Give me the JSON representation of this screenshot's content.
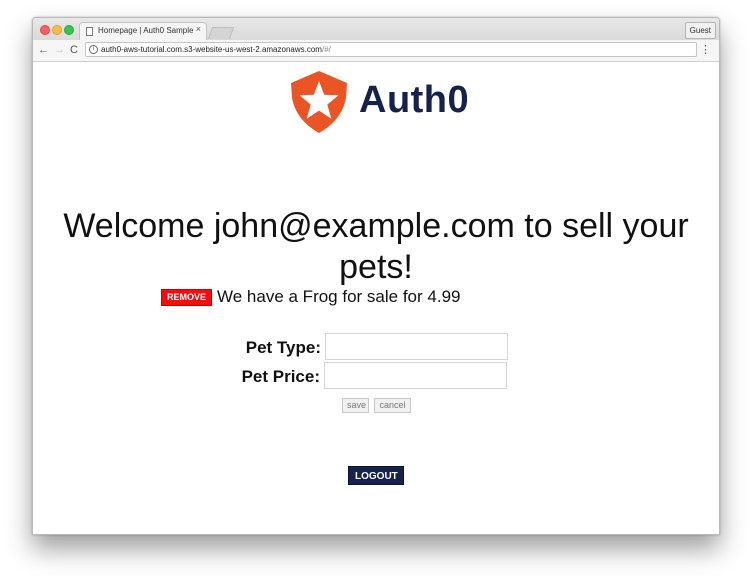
{
  "browser": {
    "tab_title": "Homepage | Auth0 Sample",
    "tab_close": "×",
    "profile_button": "Guest",
    "url_main": "auth0-aws-tutorial.com.s3-website-us-west-2.amazonaws.com",
    "url_rest": "/#/",
    "nav_back": "←",
    "nav_forward": "→",
    "nav_reload": "C",
    "menu_icon": "⋮",
    "info_icon": "i"
  },
  "page": {
    "logo_text": "Auth0",
    "brand_colors": {
      "logo_orange": "#eb5424",
      "navy": "#16214d",
      "remove_red": "#fa0a0a"
    },
    "welcome": "Welcome john@example.com to sell your pets!",
    "pet_listing": {
      "remove_label": "REMOVE",
      "text": "We have a Frog for sale for 4.99"
    },
    "form": {
      "pet_type_label": "Pet Type:",
      "pet_type_value": "",
      "pet_price_label": "Pet Price:",
      "pet_price_value": "",
      "save_label": "save",
      "cancel_label": "cancel"
    },
    "logout_label": "LOGOUT"
  }
}
